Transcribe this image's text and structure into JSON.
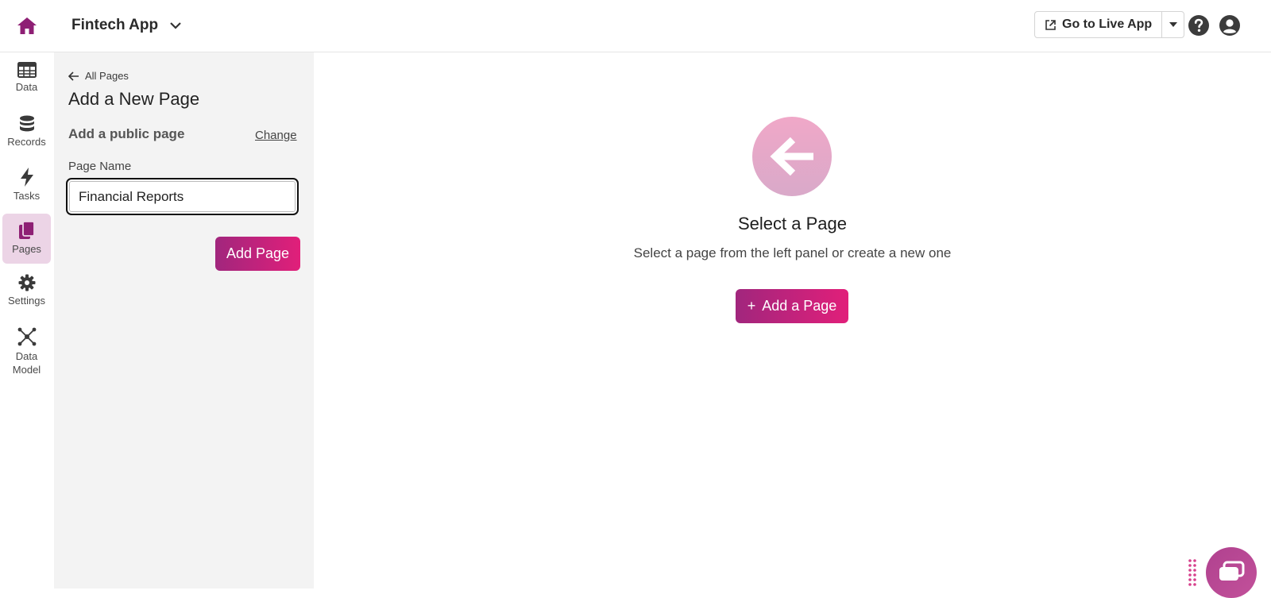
{
  "app": {
    "name": "Fintech App"
  },
  "header": {
    "go_live_label": "Go to Live App",
    "icons": {
      "home": "home-icon",
      "help": "help-icon",
      "user": "user-icon"
    }
  },
  "rail": {
    "items": [
      {
        "label": "Data",
        "icon": "table-icon"
      },
      {
        "label": "Records",
        "icon": "database-icon"
      },
      {
        "label": "Tasks",
        "icon": "bolt-icon"
      },
      {
        "label": "Pages",
        "icon": "pages-icon",
        "active": true
      },
      {
        "label": "Settings",
        "icon": "gear-icon"
      },
      {
        "label": "Data\nModel",
        "icon": "network-icon"
      }
    ]
  },
  "panel": {
    "back_label": "All Pages",
    "title": "Add a New Page",
    "page_type_label": "Add a public page",
    "change_label": "Change",
    "field_label": "Page Name",
    "page_name_value": "Financial Reports",
    "submit_label": "Add Page"
  },
  "main": {
    "empty_title": "Select a Page",
    "empty_subtitle": "Select a page from the left panel or create a new one",
    "add_button_label": "Add a Page",
    "add_button_icon": "+"
  },
  "colors": {
    "accent_start": "#a1267d",
    "accent_end": "#e11f7a",
    "active_rail_bg": "#ecd4e6",
    "home_icon": "#8e1f74"
  }
}
